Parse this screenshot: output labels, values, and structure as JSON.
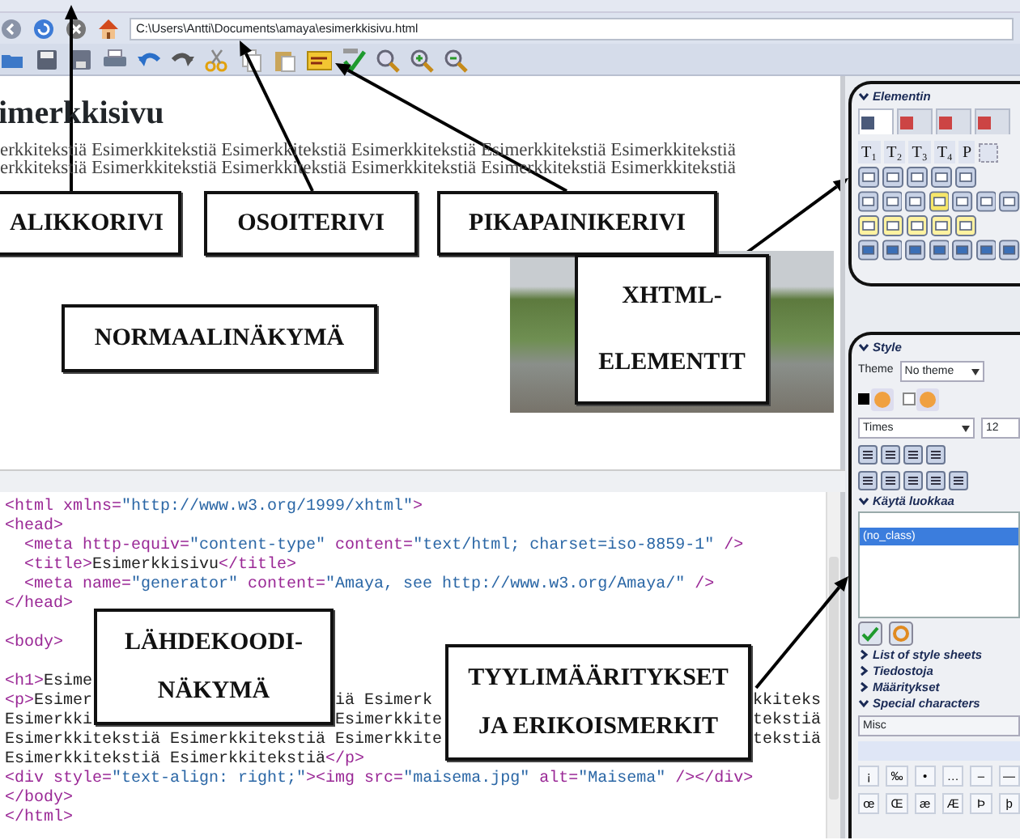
{
  "address_bar": {
    "path": "C:\\Users\\Antti\\Documents\\amaya\\esimerkkisivu.html"
  },
  "document": {
    "heading": "imerkkisivu",
    "lines": [
      "erkkitekstiä Esimerkkitekstiä Esimerkkitekstiä Esimerkkitekstiä Esimerkkitekstiä Esimerkkitekstiä",
      "erkkitekstiä Esimerkkitekstiä Esimerkkitekstiä Esimerkkitekstiä Esimerkkitekstiä Esimerkkitekstiä"
    ]
  },
  "source": {
    "blocks": [
      [
        {
          "segments": [
            {
              "kind": "tag",
              "text": "<html xmlns="
            },
            {
              "kind": "val",
              "text": "\"http://www.w3.org/1999/xhtml\""
            },
            {
              "kind": "tag",
              "text": ">"
            }
          ]
        },
        {
          "segments": [
            {
              "kind": "tag",
              "text": "<head>"
            }
          ],
          "children": [
            {
              "segments": [
                {
                  "kind": "tag",
                  "text": "<meta http-equiv="
                },
                {
                  "kind": "val",
                  "text": "\"content-type\""
                },
                {
                  "kind": "tag",
                  "text": " content="
                },
                {
                  "kind": "val",
                  "text": "\"text/html; charset=iso-8859-1\""
                },
                {
                  "kind": "tag",
                  "text": " />"
                }
              ]
            },
            {
              "segments": [
                {
                  "kind": "tag",
                  "text": "<title>"
                },
                {
                  "kind": "txt",
                  "text": "Esimerkkisivu"
                },
                {
                  "kind": "tag",
                  "text": "</title>"
                }
              ]
            },
            {
              "segments": [
                {
                  "kind": "tag",
                  "text": "<meta name="
                },
                {
                  "kind": "val",
                  "text": "\"generator\""
                },
                {
                  "kind": "tag",
                  "text": " content="
                },
                {
                  "kind": "val",
                  "text": "\"Amaya, see http://www.w3.org/Amaya/\""
                },
                {
                  "kind": "tag",
                  "text": " />"
                }
              ]
            }
          ]
        },
        {
          "segments": [
            {
              "kind": "tag",
              "text": "</head>"
            }
          ]
        }
      ],
      [
        {
          "segments": [
            {
              "kind": "tag",
              "text": "<body>"
            }
          ]
        }
      ],
      [
        {
          "segments": [
            {
              "kind": "tag",
              "text": "<h1>"
            },
            {
              "kind": "txt",
              "text": "Esime"
            }
          ]
        },
        {
          "segments": [
            {
              "kind": "tag",
              "text": "<p>"
            },
            {
              "kind": "txt",
              "text": "Esimer"
            },
            {
              "kind": "gap"
            },
            {
              "kind": "txt",
              "text": "iä Esimerk"
            },
            {
              "kind": "gap"
            },
            {
              "kind": "txt",
              "text": "kkiteks"
            }
          ]
        },
        {
          "segments": [
            {
              "kind": "txt",
              "text": "Esimerkki"
            },
            {
              "kind": "gap"
            },
            {
              "kind": "txt",
              "text": "Esimerkkite"
            },
            {
              "kind": "gap"
            },
            {
              "kind": "txt",
              "text": "tekstiä"
            }
          ]
        },
        {
          "segments": [
            {
              "kind": "txt",
              "text": "Esimerkkitekstiä Esimerkkitekstiä Esimerkkite"
            },
            {
              "kind": "gap"
            },
            {
              "kind": "txt",
              "text": "tekstiä"
            }
          ]
        },
        {
          "segments": [
            {
              "kind": "txt",
              "text": "Esimerkkitekstiä Esimerkkitekstiä"
            },
            {
              "kind": "tag",
              "text": "</p>"
            }
          ]
        },
        {
          "segments": [
            {
              "kind": "tag",
              "text": "<div style="
            },
            {
              "kind": "val",
              "text": "\"text-align: right;\""
            },
            {
              "kind": "tag",
              "text": "><img src="
            },
            {
              "kind": "val",
              "text": "\"maisema.jpg\""
            },
            {
              "kind": "tag",
              "text": " alt="
            },
            {
              "kind": "val",
              "text": "\"Maisema\""
            },
            {
              "kind": "tag",
              "text": " /></div>"
            }
          ]
        },
        {
          "segments": [
            {
              "kind": "tag",
              "text": "</body>"
            }
          ]
        },
        {
          "segments": [
            {
              "kind": "tag",
              "text": "</html>"
            }
          ]
        }
      ]
    ]
  },
  "elements_panel": {
    "title": "Elementin",
    "tabs": [
      {
        "selected": true
      },
      {
        "selected": false
      },
      {
        "selected": false
      },
      {
        "selected": false
      }
    ],
    "heading_buttons": [
      "T₁",
      "T₂",
      "T₃",
      "T₄",
      "P"
    ]
  },
  "style_panel": {
    "title": "Style",
    "theme_label": "Theme",
    "theme": "No theme",
    "font": "Times",
    "size": "12",
    "class_section": {
      "title": "Käytä luokkaa",
      "expanded": true
    },
    "classes": [
      {
        "label": "(no_class)",
        "selected": true
      }
    ],
    "sections": [
      {
        "title": "List of style sheets",
        "expanded": false
      },
      {
        "title": "Tiedostoja",
        "expanded": false
      },
      {
        "title": "Määritykset",
        "expanded": false
      },
      {
        "title": "Special characters",
        "expanded": true
      }
    ],
    "char_set": "Misc",
    "characters": [
      [
        "¡",
        "‰",
        "•",
        "…",
        "–",
        "—"
      ],
      [
        "œ",
        "Œ",
        "æ",
        "Æ",
        "Þ",
        "þ"
      ]
    ]
  },
  "callouts": [
    {
      "kind": "single",
      "text": "ALIKKORIVI"
    },
    {
      "kind": "single",
      "text": "OSOITERIVI"
    },
    {
      "kind": "single",
      "text": "PIKAPAINIKERIVI"
    },
    {
      "kind": "single",
      "text": "NORMAALINÄKYMÄ"
    },
    {
      "kind": "double",
      "lines": [
        "XHTML-",
        "ELEMENTIT"
      ]
    },
    {
      "kind": "double",
      "lines": [
        "LÄHDEKOODI-",
        "NÄKYMÄ"
      ]
    },
    {
      "kind": "double",
      "lines": [
        "TYYLIMÄÄRITYKSET",
        "JA ERIKOISMERKIT"
      ]
    }
  ]
}
